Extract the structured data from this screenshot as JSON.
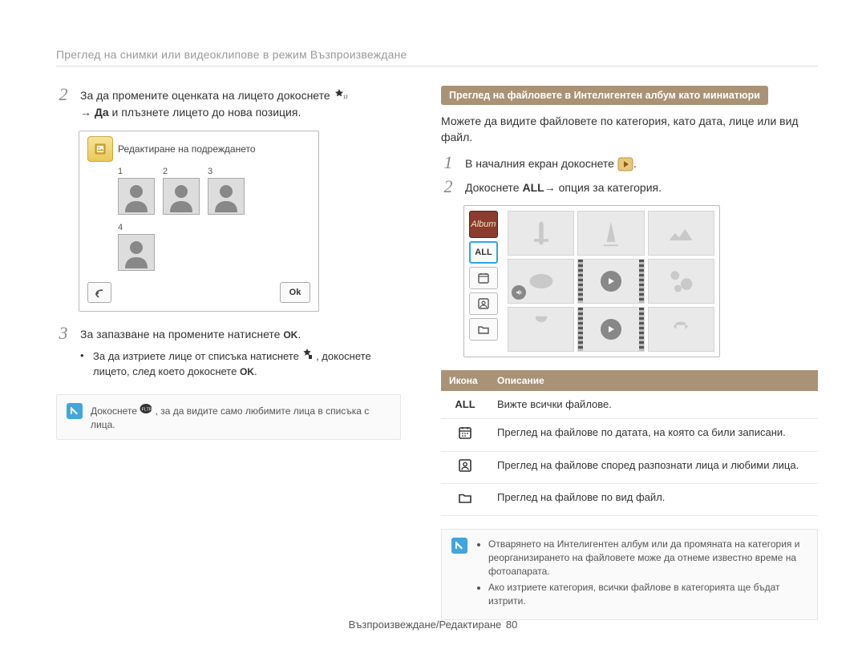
{
  "breadcrumb": "Преглед на снимки или видеоклипове в режим Възпроизвеждане",
  "left": {
    "step2_part1": "За да промените оценката на лицето докоснете ",
    "step2_part2": "→ ",
    "step2_yes": "Да",
    "step2_part3": " и плъзнете лицето до нова позиция.",
    "screen": {
      "title": "Редактиране на подреждането",
      "faces": [
        "1",
        "2",
        "3",
        "4"
      ],
      "ok": "Ok"
    },
    "step3": "За запазване на промените натиснете ",
    "sub_step_a": "За да изтриете лице от списъка натиснете ",
    "sub_step_b": ", докоснете лицето, след което докоснете ",
    "note_a": "Докоснете ",
    "note_b": ", за да видите само любимите лица в списъка с лица."
  },
  "right": {
    "section_header": "Преглед на файловете в Интелигентен албум като миниатюри",
    "para": "Можете да видите файловете по категория, като дата, лице или вид файл.",
    "step1": "В началния екран докоснете ",
    "step2_a": "Докоснете ",
    "step2_all": "ALL",
    "step2_b": "→ опция за категория.",
    "browse": {
      "album_label": "Album",
      "all": "ALL"
    },
    "table": {
      "head_icon": "Икона",
      "head_desc": "Описание",
      "rows": [
        {
          "icon": "ALL",
          "desc": "Вижте всички файлове."
        },
        {
          "icon": "calendar",
          "desc": "Преглед на файлове по датата, на която са били записани."
        },
        {
          "icon": "person",
          "desc": "Преглед на файлове според разпознати лица и любими лица."
        },
        {
          "icon": "folder",
          "desc": "Преглед на файлове по вид файл."
        }
      ]
    },
    "note_items": [
      "Отварянето на Интелигентен албум или да промяната на категория и реорганизирането на файловете може да отнеме известно време на фотоапарата.",
      "Ако изтриете категория, всички файлове в категорията ще бъдат изтрити."
    ]
  },
  "footer": {
    "text": "Възпроизвеждане/Редактиране",
    "page": "80"
  }
}
